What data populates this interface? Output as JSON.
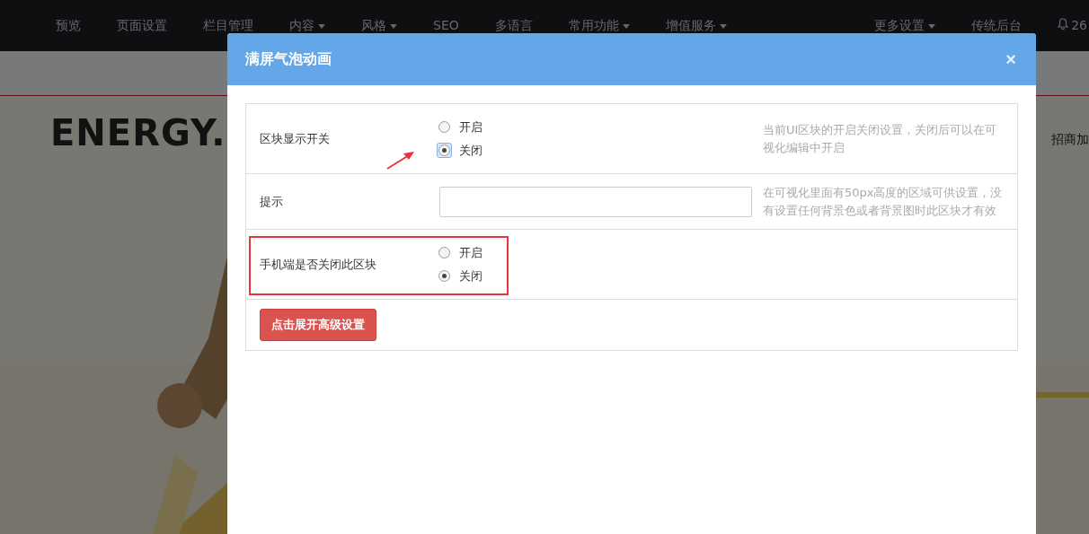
{
  "nav": {
    "items": [
      {
        "label": "预览",
        "dropdown": false
      },
      {
        "label": "页面设置",
        "dropdown": false
      },
      {
        "label": "栏目管理",
        "dropdown": false
      },
      {
        "label": "内容",
        "dropdown": true
      },
      {
        "label": "风格",
        "dropdown": true
      },
      {
        "label": "SEO",
        "dropdown": false
      },
      {
        "label": "多语言",
        "dropdown": false
      },
      {
        "label": "常用功能",
        "dropdown": true
      },
      {
        "label": "增值服务",
        "dropdown": true
      }
    ],
    "right_items": [
      {
        "label": "更多设置",
        "dropdown": true
      },
      {
        "label": "传统后台",
        "dropdown": false
      }
    ],
    "notifications": "26"
  },
  "background": {
    "brand": "ENERGY.",
    "side_link": "招商加"
  },
  "modal": {
    "title": "满屏气泡动画",
    "close": "×",
    "rows": [
      {
        "kind": "radio",
        "label": "区块显示开关",
        "options": [
          {
            "label": "开启",
            "selected": false,
            "focused": false
          },
          {
            "label": "关闭",
            "selected": true,
            "focused": true
          }
        ],
        "hint": "当前UI区块的开启关闭设置，关闭后可以在可视化编辑中开启",
        "highlighted": false,
        "arrow": true
      },
      {
        "kind": "text",
        "label": "提示",
        "hint": "在可视化里面有50px高度的区域可供设置，没有设置任何背景色或者背景图时此区块才有效",
        "highlighted": false,
        "arrow": false
      },
      {
        "kind": "radio",
        "label": "手机端是否关闭此区块",
        "options": [
          {
            "label": "开启",
            "selected": false,
            "focused": false
          },
          {
            "label": "关闭",
            "selected": true,
            "focused": false
          }
        ],
        "highlighted": true,
        "arrow": false
      }
    ],
    "advanced_button": "点击展开高级设置"
  }
}
